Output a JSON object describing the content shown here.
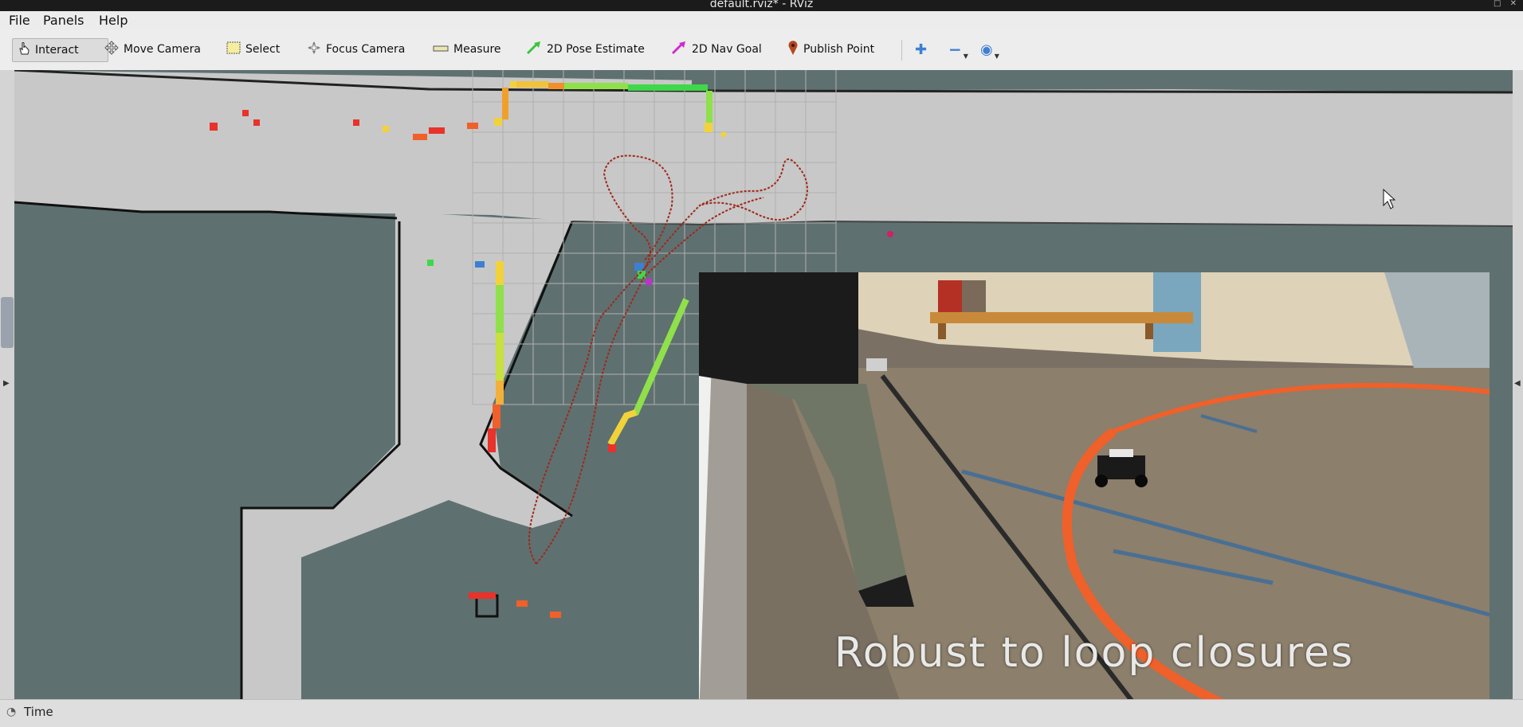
{
  "window": {
    "title": "default.rviz* - RViz",
    "controls": "□ ✕"
  },
  "menu": {
    "file": "File",
    "panels": "Panels",
    "help": "Help"
  },
  "toolbar": {
    "interact": "Interact",
    "move_camera": "Move Camera",
    "select": "Select",
    "focus_camera": "Focus Camera",
    "measure": "Measure",
    "pose_estimate": "2D Pose Estimate",
    "nav_goal": "2D Nav Goal",
    "publish_point": "Publish Point",
    "zoom_in_glyph": "✚",
    "zoom_out_glyph": "−",
    "view_glyph": "◉"
  },
  "status": {
    "time_label": "Time"
  },
  "video": {
    "caption": "Robust to loop closures"
  },
  "colors": {
    "map_free": "#c8c8c8",
    "map_unknown": "#5f7070",
    "map_wall": "#111111",
    "trajectory": "#a0281a",
    "scan_near": "#e8322a",
    "scan_mid": "#f2d23a",
    "scan_far": "#3fd84a",
    "tape_orange": "#f0602a"
  },
  "icons": {
    "interact": "hand-pointer-icon",
    "move_camera": "move-arrows-icon",
    "select": "selection-box-icon",
    "focus_camera": "focus-target-icon",
    "measure": "ruler-icon",
    "pose_estimate": "green-arrow-icon",
    "nav_goal": "magenta-arrow-icon",
    "publish_point": "map-pin-icon",
    "status_time": "clock-icon"
  }
}
